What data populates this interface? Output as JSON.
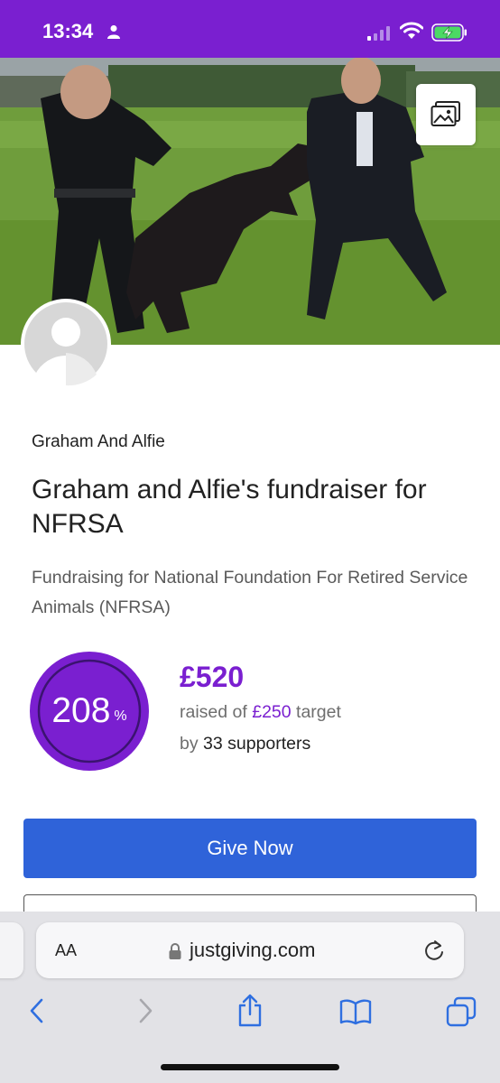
{
  "status_bar": {
    "time": "13:34",
    "background": "#7a1fd0",
    "icons": [
      "person-icon",
      "cellular-signal-icon",
      "wifi-icon",
      "battery-charging-icon"
    ]
  },
  "hero": {
    "image": "photo-of-dog-handlers-with-black-dog-on-grass",
    "gallery_icon": "image-gallery-icon"
  },
  "profile": {
    "avatar_icon": "default-avatar-icon",
    "owner_name": "Graham And Alfie"
  },
  "page": {
    "title": "Graham and Alfie's fundraiser for NFRSA",
    "subtitle": "Fundraising for National Foundation For Retired Service Animals (NFRSA)"
  },
  "progress": {
    "percent_value": "208",
    "percent_unit": "%",
    "percent_fraction": 2.08,
    "raised": "£520",
    "target_prefix": "raised of",
    "target_amount": "£250",
    "target_suffix": "target",
    "supporters_prefix": "by",
    "supporters_count": "33 supporters",
    "accent": "#7a1fd0"
  },
  "actions": {
    "give_now": "Give Now",
    "give_now_color": "#2f63d9"
  },
  "browser": {
    "text_size_label": "AA",
    "url": "justgiving.com",
    "toolbar_icons": [
      "back-icon",
      "forward-icon",
      "share-icon",
      "bookmarks-icon",
      "tabs-icon"
    ]
  }
}
